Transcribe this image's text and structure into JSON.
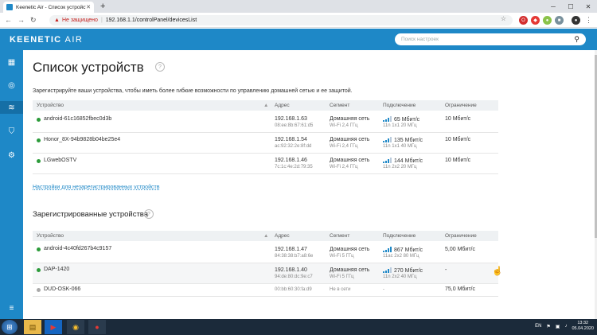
{
  "browser": {
    "tab_title": "Keenetic Air - Список устройств",
    "tab_close": "✕",
    "new_tab": "+",
    "not_secure": "Не защищено",
    "url": "192.168.1.1/controlPanel/devicesList"
  },
  "header": {
    "logo_main": "KEENETIC",
    "logo_sub": "AIR",
    "search_placeholder": "Поиск настроек"
  },
  "page": {
    "title": "Список устройств",
    "description": "Зарегистрируйте ваши устройства, чтобы иметь более гибкие возможности по управлению домашней сетью и ее защитой.",
    "unregistered_settings_link": "Настройки для незарегистрированных устройств",
    "registered_title": "Зарегистрированные устройства"
  },
  "columns": [
    "Устройство",
    "Адрес",
    "Сегмент",
    "Подключение",
    "Ограничение"
  ],
  "unregistered": [
    {
      "name": "android-61c16852fbec0d3b",
      "ip": "192.168.1.63",
      "mac": "08:ee:8b:67:61:d5",
      "segment": "Домашняя сеть",
      "band": "Wi-Fi 2,4 ГГц",
      "speed": "65 Мбит/с",
      "mode": "11n 1x1 20 МГц",
      "limit": "10 Мбит/с",
      "status": "online"
    },
    {
      "name": "Honor_8X-94b9828b04be25e4",
      "ip": "192.168.1.54",
      "mac": "ac:92:32:2e:8f:dd",
      "segment": "Домашняя сеть",
      "band": "Wi-Fi 2,4 ГГц",
      "speed": "135 Мбит/с",
      "mode": "11n 1x1 40 МГц",
      "limit": "10 Мбит/с",
      "status": "online"
    },
    {
      "name": "LGwebOSTV",
      "ip": "192.168.1.46",
      "mac": "7c:1c:4e:2d:79:35",
      "segment": "Домашняя сеть",
      "band": "Wi-Fi 2,4 ГГц",
      "speed": "144 Мбит/с",
      "mode": "11n 2x2 20 МГц",
      "limit": "10 Мбит/с",
      "status": "online"
    }
  ],
  "registered": [
    {
      "name": "android-4c40fd267b4c9157",
      "ip": "192.168.1.47",
      "mac": "84:38:38:b7:a8:6e",
      "segment": "Домашняя сеть",
      "band": "Wi-Fi 5 ГГц",
      "speed": "867 Мбит/с",
      "mode": "11ac 2x2 80 МГц",
      "limit": "5,00 Мбит/с",
      "status": "online"
    },
    {
      "name": "DAP-1420",
      "ip": "192.168.1.40",
      "mac": "94:de:80:dc:9e:c7",
      "segment": "Домашняя сеть",
      "band": "Wi-Fi 5 ГГц",
      "speed": "270 Мбит/с",
      "mode": "11n 2x2 40 МГц",
      "limit": "-",
      "status": "online"
    },
    {
      "name": "DUD-OSK-066",
      "ip": "",
      "mac": "00:bb:60:30:fa:d9",
      "segment": "Не в сети",
      "band": "",
      "speed": "-",
      "mode": "",
      "limit": "75,0 Мбит/с",
      "status": "offline"
    }
  ],
  "taskbar": {
    "lang": "EN",
    "time": "13:32",
    "date": "05.04.2020"
  },
  "colors": {
    "brand": "#1e88c7",
    "online": "#2c9b3a",
    "offline": "#aaaaaa"
  }
}
